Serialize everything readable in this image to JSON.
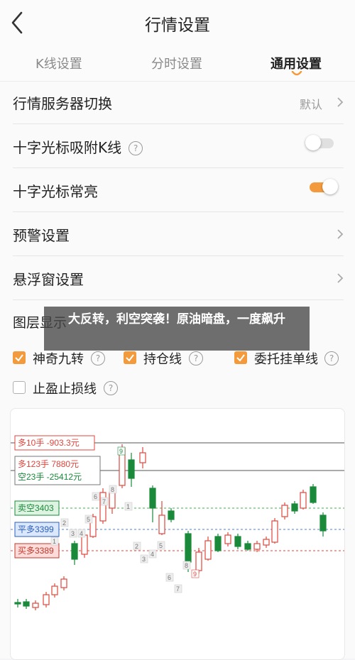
{
  "header": {
    "title": "行情设置"
  },
  "tabs": [
    {
      "label": "K线设置"
    },
    {
      "label": "分时设置"
    },
    {
      "label": "通用设置"
    }
  ],
  "settings": [
    {
      "label": "行情服务器切换",
      "value": "默认"
    },
    {
      "label": "十字光标吸附K线",
      "state": "off"
    },
    {
      "label": "十字光标常亮",
      "state": "on"
    },
    {
      "label": "预警设置"
    },
    {
      "label": "悬浮窗设置"
    }
  ],
  "layers": {
    "title": "图层显示",
    "options": [
      {
        "label": "神奇九转",
        "checked": true
      },
      {
        "label": "持仓线",
        "checked": true
      },
      {
        "label": "委托挂单线",
        "checked": true
      },
      {
        "label": "止盈止损线",
        "checked": false
      }
    ]
  },
  "chart_data": {
    "type": "candlestick",
    "title": "",
    "lines": [
      {
        "label": "多10手",
        "value": "-903.3元",
        "style": "solid",
        "color": "#777777"
      },
      {
        "label": "多123手",
        "value": "7880元",
        "style": "solid",
        "color": "#777777"
      },
      {
        "label": "空23手",
        "value": "-25412元",
        "style": "solid",
        "color": "#777777"
      },
      {
        "label": "卖空3403",
        "style": "dashed",
        "color": "#3bb34a"
      },
      {
        "label": "平多3399",
        "style": "dashed",
        "color": "#4a7fe0"
      },
      {
        "label": "买多3389",
        "style": "dashed",
        "color": "#e0453c"
      }
    ],
    "nine_turn_marks": [
      "1",
      "2",
      "3",
      "4",
      "5",
      "6",
      "7",
      "8",
      "9",
      "1",
      "2",
      "3",
      "4",
      "5",
      "6",
      "7",
      "8",
      "9"
    ],
    "colors": {
      "up": "#e0453c",
      "down": "#1a8a3a"
    }
  },
  "overlay": {
    "text": "大反转，利空突袭！原油暗盘，一度飙升"
  },
  "colors": {
    "accent": "#f39b3c"
  }
}
